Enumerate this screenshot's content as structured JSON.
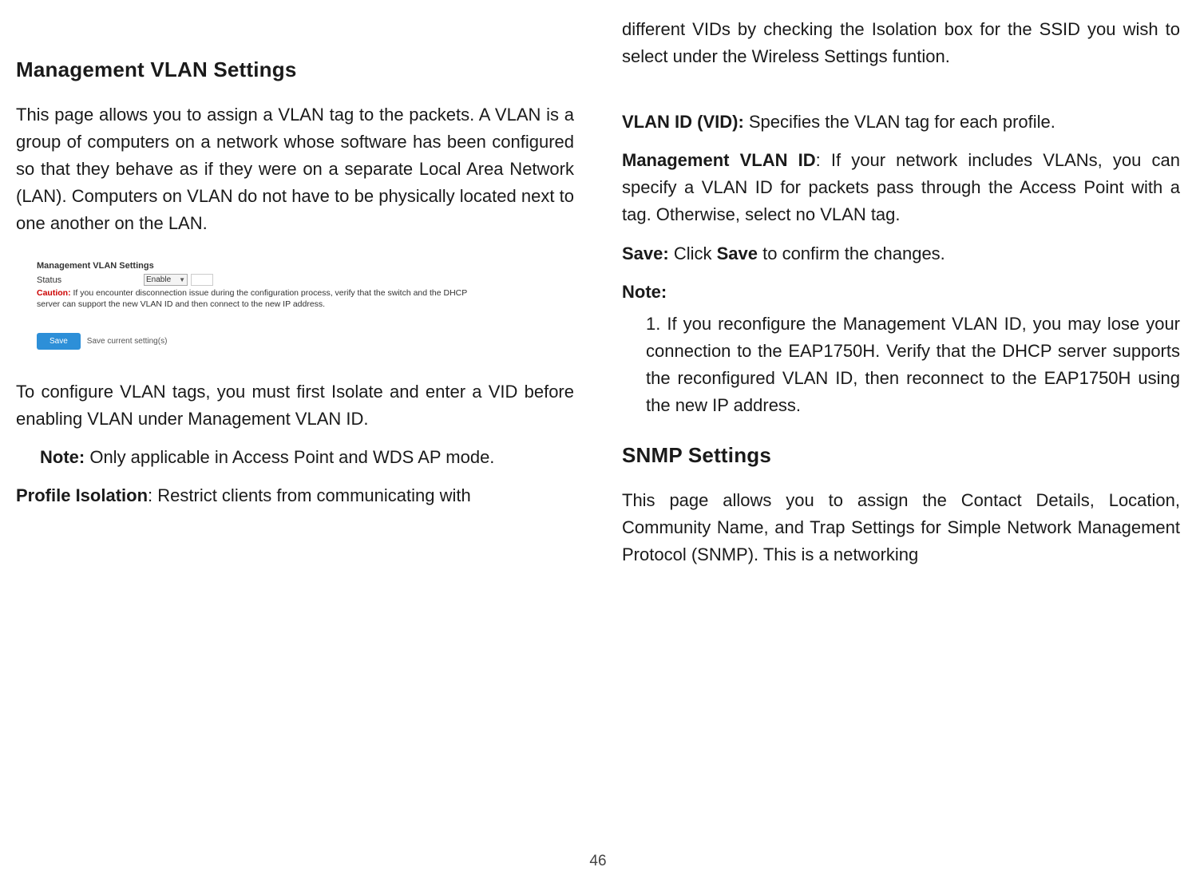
{
  "page_number": "46",
  "left": {
    "heading": "Management VLAN Settings",
    "intro": "This page allows you to assign a VLAN tag to the packets. A VLAN is a group of computers on a network whose software has been configured so that they behave as if they were on a separate Local Area Network (LAN). Computers on VLAN do not have to be physically located next to one another on the LAN.",
    "screenshot": {
      "title": "Management VLAN Settings",
      "status_label": "Status",
      "status_value": "Enable",
      "caution_label": "Caution:",
      "caution_text": "If you encounter disconnection issue during the configuration process, verify that the switch and the DHCP server can support the new VLAN ID and then connect to the new IP address.",
      "save_button": "Save",
      "save_hint": "Save current setting(s)"
    },
    "config_text": "To configure VLAN tags, you must first Isolate and enter a VID before enabling VLAN under Management VLAN ID.",
    "note_label": "Note:",
    "note_text": " Only applicable in Access Point and WDS AP mode.",
    "profile_iso_label": "Profile Isolation",
    "profile_iso_text": ": Restrict clients from communicating with"
  },
  "right": {
    "continuation": "different VIDs by checking the Isolation box for the SSID you wish to select under the Wireless Settings funtion.",
    "vlan_id_label": "VLAN ID (VID):",
    "vlan_id_text": " Specifies the VLAN tag for each profile.",
    "mgmt_vlan_label": "Management VLAN ID",
    "mgmt_vlan_text": ": If your network includes VLANs, you can specify a VLAN ID for packets pass through the Access Point with a tag. Otherwise, select no VLAN tag.",
    "save_label": "Save:",
    "save_text_pre": " Click ",
    "save_bold": "Save",
    "save_text_post": " to confirm the changes.",
    "note_label": "Note:",
    "note_item": "1. If you reconfigure the Management VLAN ID, you may lose your connection to the EAP1750H. Verify that the DHCP server supports the reconfigured VLAN ID, then reconnect to the EAP1750H using the new IP address.",
    "snmp_heading": "SNMP Settings",
    "snmp_intro": "This page allows you to assign the Contact Details, Location, Community Name, and Trap Settings for Simple Network Management Protocol (SNMP). This is a networking"
  }
}
